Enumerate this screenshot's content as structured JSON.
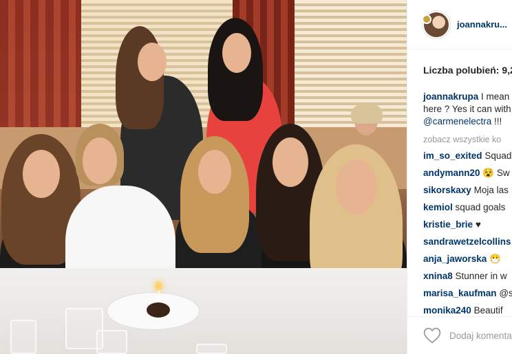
{
  "post": {
    "username": "joannakru...",
    "likes_label": "Liczba polubień: 9,2"
  },
  "caption": {
    "user": "joannakrupa",
    "line1": "I mean",
    "line2": "here ? Yes it can with",
    "mention": "@carmenelectra",
    "tail": "!!!"
  },
  "see_all": "zobacz wszystkie ko",
  "comments": [
    {
      "user": "im_so_exited",
      "text": "Squad"
    },
    {
      "user": "andymann20",
      "text": "😵 Sw"
    },
    {
      "user": "sikorskaxy",
      "text": "Moja las"
    },
    {
      "user": "kemiol",
      "text": "squad goals"
    },
    {
      "user": "kristie_brie",
      "text": "♥"
    },
    {
      "user": "sandrawetzelcollins",
      "text": ""
    },
    {
      "user": "anja_jaworska",
      "text": "😷"
    },
    {
      "user": "xnina8",
      "text": "Stunner in w"
    },
    {
      "user": "marisa_kaufman",
      "text": "@s"
    },
    {
      "user": "monika240",
      "text": "Beautif"
    }
  ],
  "footer": {
    "add_comment_placeholder": "Dodaj komentarz"
  },
  "icons": {
    "like": "heart-icon"
  }
}
